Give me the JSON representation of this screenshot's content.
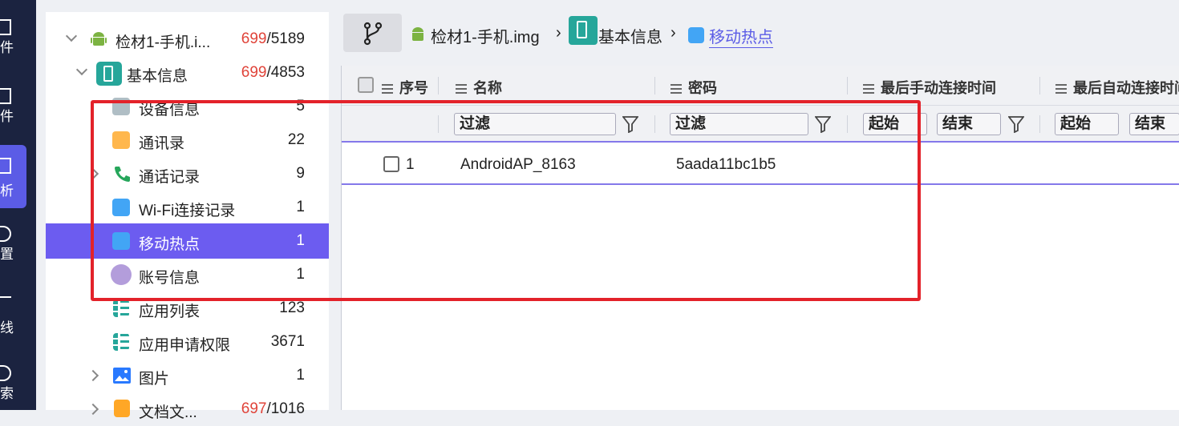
{
  "rail": {
    "items": [
      {
        "label": "件"
      },
      {
        "label": "件"
      },
      {
        "label": "析"
      },
      {
        "label": "置"
      },
      {
        "label": "线"
      },
      {
        "label": "索"
      }
    ]
  },
  "tree": {
    "root": {
      "label": "检材1-手机.i...",
      "count_red": "699",
      "count_rest": "/5189"
    },
    "group": {
      "label": "基本信息",
      "count_red": "699",
      "count_rest": "/4853"
    },
    "items": [
      {
        "label": "设备信息",
        "count": "5",
        "icon": "device-info-icon"
      },
      {
        "label": "通讯录",
        "count": "22",
        "icon": "contacts-icon"
      },
      {
        "label": "通话记录",
        "count": "9",
        "icon": "phone-icon"
      },
      {
        "label": "Wi-Fi连接记录",
        "count": "1",
        "icon": "wifi-icon"
      },
      {
        "label": "移动热点",
        "count": "1",
        "icon": "wifi-icon"
      },
      {
        "label": "账号信息",
        "count": "1",
        "icon": "account-icon"
      },
      {
        "label": "应用列表",
        "count": "123",
        "icon": "list-icon"
      },
      {
        "label": "应用申请权限",
        "count": "3671",
        "icon": "list-icon"
      },
      {
        "label": "图片",
        "count": "1",
        "icon": "image-icon"
      },
      {
        "label": "文档文...",
        "count_red": "697",
        "count_rest": "/1016",
        "icon": "document-icon"
      }
    ]
  },
  "breadcrumb": {
    "device": "检材1-手机.img",
    "category": "基本信息",
    "current": "移动热点"
  },
  "table": {
    "headers": {
      "seq": "序号",
      "name": "名称",
      "password": "密码",
      "manual_time": "最后手动连接时间",
      "auto_time": "最后自动连接时间"
    },
    "filter_placeholder": "过滤",
    "start_label": "起始",
    "end_label": "结束",
    "rows": [
      {
        "seq": "1",
        "name": "AndroidAP_8163",
        "password": "5aada11bc1b5"
      }
    ]
  },
  "colors": {
    "accent": "#6c5cf0",
    "highlight_box": "#e3222a",
    "rail_bg": "#1b2340",
    "count_red": "#e0443a"
  }
}
